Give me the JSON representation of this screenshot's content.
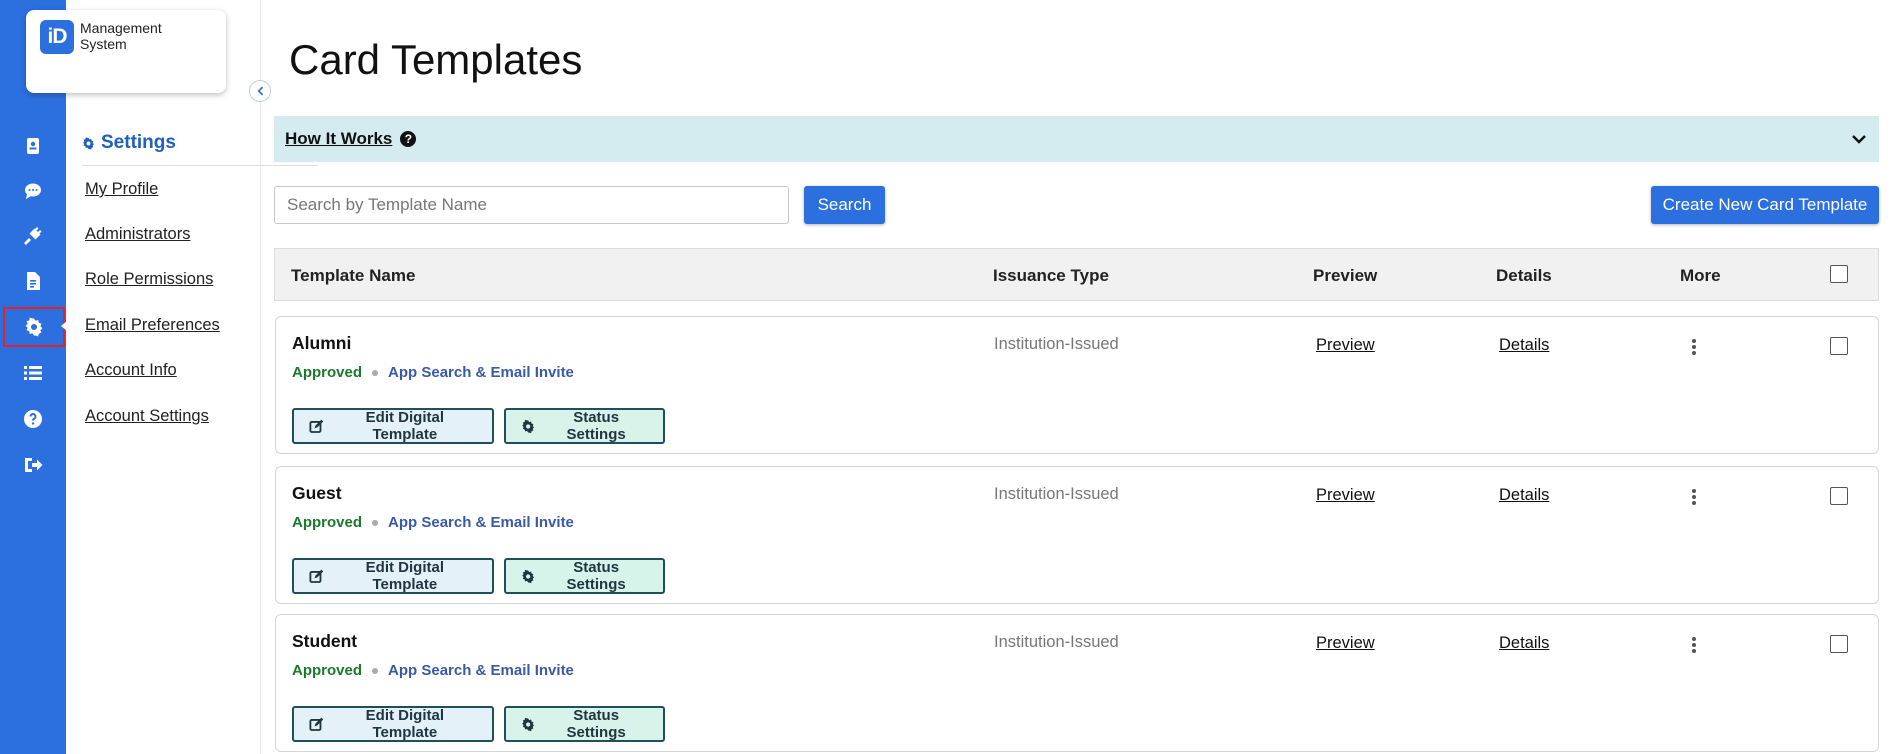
{
  "logo": {
    "mark": "iD",
    "line1": "Management",
    "line2": "System"
  },
  "rail_icons": [
    "id-card-icon",
    "chat-icon",
    "plug-icon",
    "document-icon",
    "gear-icon",
    "list-icon",
    "help-icon",
    "logout-icon"
  ],
  "subnav": {
    "title": "Settings",
    "items": [
      "My Profile",
      "Administrators",
      "Role Permissions",
      "Email Preferences",
      "Account Info",
      "Account Settings"
    ]
  },
  "page": {
    "title": "Card Templates",
    "how_it_works": "How It Works",
    "help_glyph": "?",
    "search_placeholder": "Search by Template Name",
    "search_button": "Search",
    "create_button": "Create New Card Template"
  },
  "table": {
    "headers": [
      "Template Name",
      "Issuance Type",
      "Preview",
      "Details",
      "More"
    ],
    "rows": [
      {
        "name": "Alumni",
        "status": "Approved",
        "invite": "App Search & Email Invite",
        "type": "Institution-Issued",
        "preview": "Preview",
        "details": "Details",
        "edit": "Edit Digital Template",
        "status_settings": "Status Settings"
      },
      {
        "name": "Guest",
        "status": "Approved",
        "invite": "App Search & Email Invite",
        "type": "Institution-Issued",
        "preview": "Preview",
        "details": "Details",
        "edit": "Edit Digital Template",
        "status_settings": "Status Settings"
      },
      {
        "name": "Student",
        "status": "Approved",
        "invite": "App Search & Email Invite",
        "type": "Institution-Issued",
        "preview": "Preview",
        "details": "Details",
        "edit": "Edit Digital Template",
        "status_settings": "Status Settings"
      }
    ]
  },
  "colors": {
    "brand": "#2c6fdf",
    "approved": "#1c7a2c",
    "accent_bar": "#d4ebef"
  }
}
